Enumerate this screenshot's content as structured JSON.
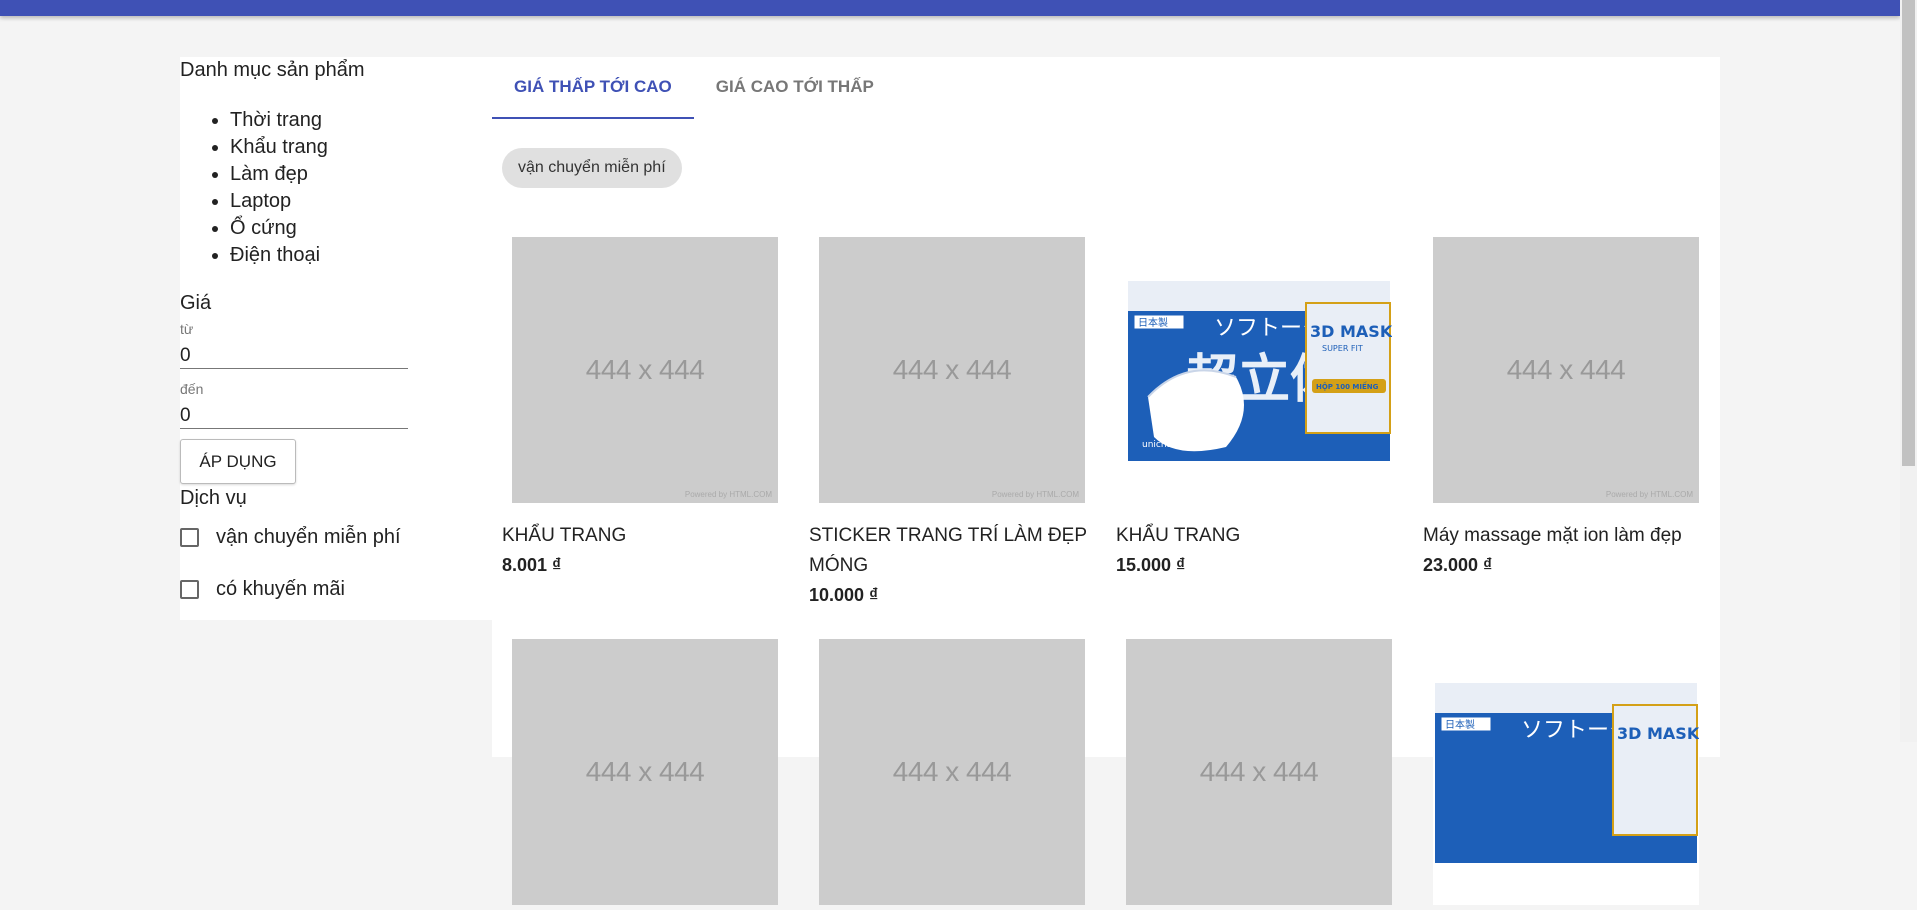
{
  "sidebar": {
    "title": "Danh mục sản phẩm",
    "categories": [
      "Thời trang",
      "Khẩu trang",
      "Làm đẹp",
      "Laptop",
      "Ổ cứng",
      "Điện thoại"
    ],
    "price": {
      "title": "Giá",
      "from_label": "từ",
      "from_value": "0",
      "to_label": "đến",
      "to_value": "0",
      "apply_label": "áp dụng"
    },
    "services": {
      "title": "Dịch vụ",
      "options": [
        "vận chuyển miễn phí",
        "có khuyến mãi"
      ]
    }
  },
  "main": {
    "tabs": [
      "Giá thấp tới cao",
      "Giá cao tới thấp"
    ],
    "active_tab": 0,
    "filter_chip": "vận chuyển miễn phí",
    "products": [
      {
        "name": "Khẩu trang",
        "price": "8.001 ₫",
        "image": "444 x 444",
        "powered": "Powered by HTML.COM"
      },
      {
        "name": "Sticker trang trí làm đẹp móng",
        "price": "10.000 ₫",
        "image": "444 x 444",
        "powered": "Powered by HTML.COM"
      },
      {
        "name": "Khẩu trang",
        "price": "15.000 ₫",
        "image_text": [
          "日本製",
          "ソフトーク",
          "超立体",
          "3D MASK",
          "SUPER FIT",
          "HỘP 100 MIẾNG",
          "unicharm"
        ]
      },
      {
        "name": "Máy massage mặt ion làm đẹp",
        "price": "23.000 ₫",
        "image": "444 x 444",
        "powered": "Powered by HTML.COM"
      }
    ],
    "second_row": [
      {
        "image": "444 x 444"
      },
      {
        "image": "444 x 444"
      },
      {
        "image": "444 x 444"
      },
      {
        "image_text": [
          "日本製",
          "ソフトーク",
          "3D MASK"
        ]
      }
    ]
  },
  "colors": {
    "primary": "#3f51b5",
    "placeholder": "#cccccc",
    "page_bg": "#f4f4f4"
  }
}
